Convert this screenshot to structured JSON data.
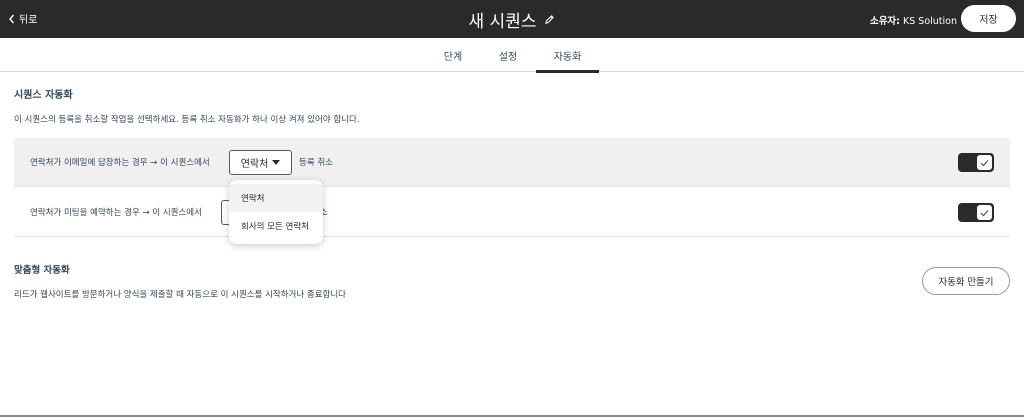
{
  "header": {
    "back_label": "뒤로",
    "title": "새 시퀀스",
    "owner_label": "소유자:",
    "owner_name": "KS Solution",
    "save_label": "저장"
  },
  "tabs": [
    {
      "label": "단계"
    },
    {
      "label": "설정"
    },
    {
      "label": "자동화",
      "active": true
    }
  ],
  "sequence_automation": {
    "heading": "시퀀스 자동화",
    "description": "이 시퀀스의 등록을 취소할 작업을 선택하세요. 등록 취소 자동화가 하나 이상 켜져 있어야 합니다.",
    "rows": [
      {
        "text": "연락처가 이메일에 답장하는 경우 → 이 시퀀스에서",
        "dropdown": "연락처",
        "after": "등록 취소",
        "enabled": true
      },
      {
        "text": "연락처가 미팅을 예약하는 경우 → 이 시퀀스에서",
        "after": "소",
        "enabled": true
      }
    ]
  },
  "dropdown_menu": {
    "options": [
      "연락처",
      "회사의 모든 연락처"
    ],
    "selected": "연락처"
  },
  "custom_automation": {
    "heading": "맞춤형 자동화",
    "description": "리드가 웹사이트를 방문하거나 양식을 제출할 때 자동으로 이 시퀀스를 시작하거나 종료합니다",
    "create_button": "자동화 만들기"
  },
  "colors": {
    "topbar": "#2a2a2a",
    "text": "#33475b",
    "highlight_row": "#f0f0f0",
    "toggle_on": "#2a2a2a"
  },
  "icons": [
    "chevron-left-icon",
    "pencil-icon",
    "caret-down-icon",
    "check-icon"
  ]
}
